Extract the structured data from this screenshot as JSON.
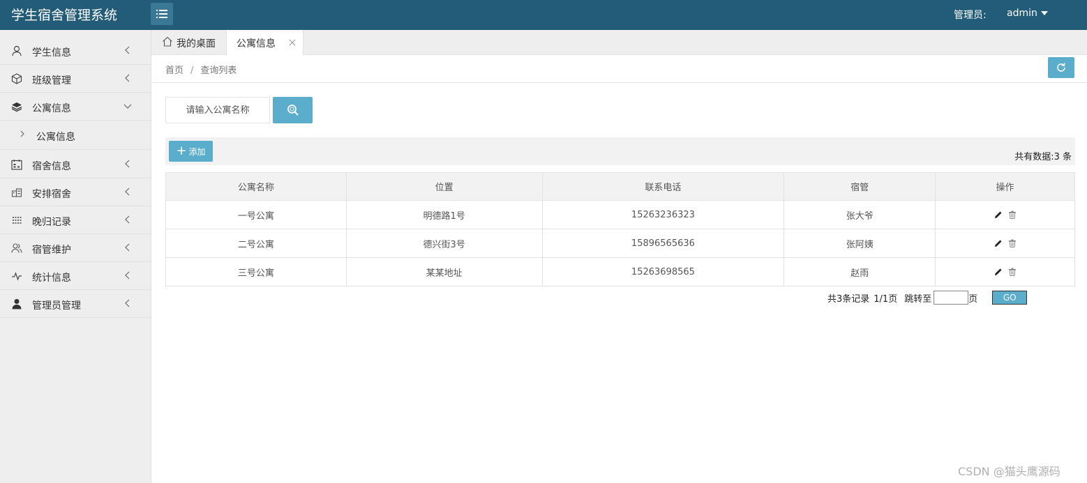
{
  "header": {
    "logo": "学生宿舍管理系统",
    "admin_label": "管理员:",
    "admin_name": "admin"
  },
  "sidebar": {
    "items": [
      {
        "label": "学生信息",
        "icon": "user-icon"
      },
      {
        "label": "班级管理",
        "icon": "cube-icon"
      },
      {
        "label": "公寓信息",
        "icon": "layers-icon",
        "expanded": true
      },
      {
        "label": "宿舍信息",
        "icon": "calendar-icon"
      },
      {
        "label": "安排宿舍",
        "icon": "building-icon"
      },
      {
        "label": "晚归记录",
        "icon": "grid-icon"
      },
      {
        "label": "宿管维护",
        "icon": "users-icon"
      },
      {
        "label": "统计信息",
        "icon": "pulse-icon"
      },
      {
        "label": "管理员管理",
        "icon": "person-icon"
      }
    ],
    "sub_item": "公寓信息"
  },
  "tabs": {
    "home": "我的桌面",
    "active": "公寓信息"
  },
  "breadcrumb": {
    "home": "首页",
    "separator": "/",
    "current": "查询列表"
  },
  "search": {
    "placeholder": "请输入公寓名称"
  },
  "toolbar": {
    "add_label": "添加",
    "total_text": "共有数据:3 条"
  },
  "table": {
    "headers": [
      "公寓名称",
      "位置",
      "联系电话",
      "宿管",
      "操作"
    ],
    "rows": [
      [
        "一号公寓",
        "明德路1号",
        "15263236323",
        "张大爷"
      ],
      [
        "二号公寓",
        "德兴街3号",
        "15896565636",
        "张阿姨"
      ],
      [
        "三号公寓",
        "某某地址",
        "15263698565",
        "赵雨"
      ]
    ]
  },
  "pager": {
    "records": "共3条记录",
    "pages": "1/1页",
    "jump_label": "跳转至",
    "page_unit": "页",
    "go_label": "GO"
  },
  "watermark": "CSDN @猫头鹰源码",
  "colors": {
    "header_bg": "#225c78",
    "accent": "#5aaecb",
    "sidebar_bg": "#eeeeee"
  }
}
